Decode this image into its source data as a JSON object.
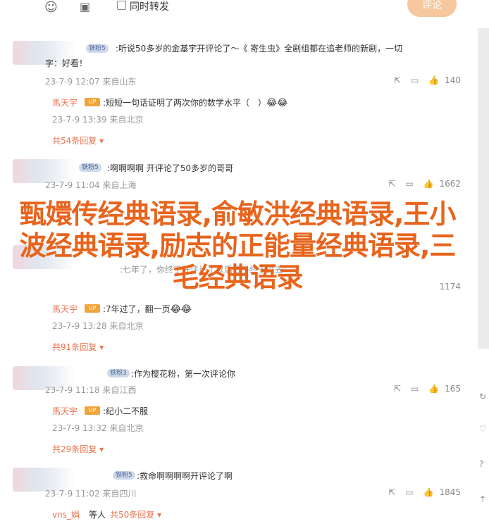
{
  "toolbar": {
    "emoji_icon": "smiley-icon",
    "image_icon": "image-icon",
    "forward_label": "同时转发",
    "post_button": "评论"
  },
  "comments": [
    {
      "badge": "铁粉5",
      "text": ":听说50多岁的金基宇开评论了～《 寄生虫》全剧组都在追",
      "text_tail": "老师的新剧，一切",
      "line2": "字：好看！",
      "time": "23-7-9 12:07",
      "location": "来自山东",
      "likes": "140",
      "reply": {
        "name": "馬天宇",
        "text": ":短短一句话证明了两次你的数学水平（　）",
        "time": "23-7-9 13:39",
        "location": "来自北京"
      },
      "more": "共54条回复"
    },
    {
      "badge": "铁粉5",
      "text": ":啊啊啊啊 开评论了50多岁的哥哥",
      "time": "23-7-9 11:04",
      "location": "来自上海",
      "likes": "1662"
    },
    {
      "badge": "",
      "text": ":七年了，你终于开评论了",
      "text_tail": "以后日子终于过去",
      "time": "",
      "location": "",
      "likes": "1174",
      "reply": {
        "name": "馬天宇",
        "text": ":7年过了，翻一页",
        "time": "23-7-9 13:28",
        "location": "来自北京"
      },
      "more": "共91条回复"
    },
    {
      "badge": "铁粉3",
      "text": ":作为樱花粉，第一次评论你",
      "time": "23-7-9 11:18",
      "location": "来自江西",
      "likes": "165",
      "reply": {
        "name": "馬天宇",
        "text": ":纪小二不服",
        "time": "23-7-9 13:32",
        "location": "来自北京"
      },
      "more": "共29条回复"
    },
    {
      "badge": "铁粉5",
      "text": ":救命啊啊啊啊开评论了啊",
      "time": "23-7-9 11:02",
      "location": "来自四川",
      "likes": "1845",
      "reply_preview": {
        "name": "vns_娟",
        "action": "等人",
        "more": "共50条回复"
      }
    }
  ],
  "overlay_title": "甄嬛传经典语录,俞敏洪经典语录,王小波经典语录,励志的正能量经典语录,三毛经典语录"
}
